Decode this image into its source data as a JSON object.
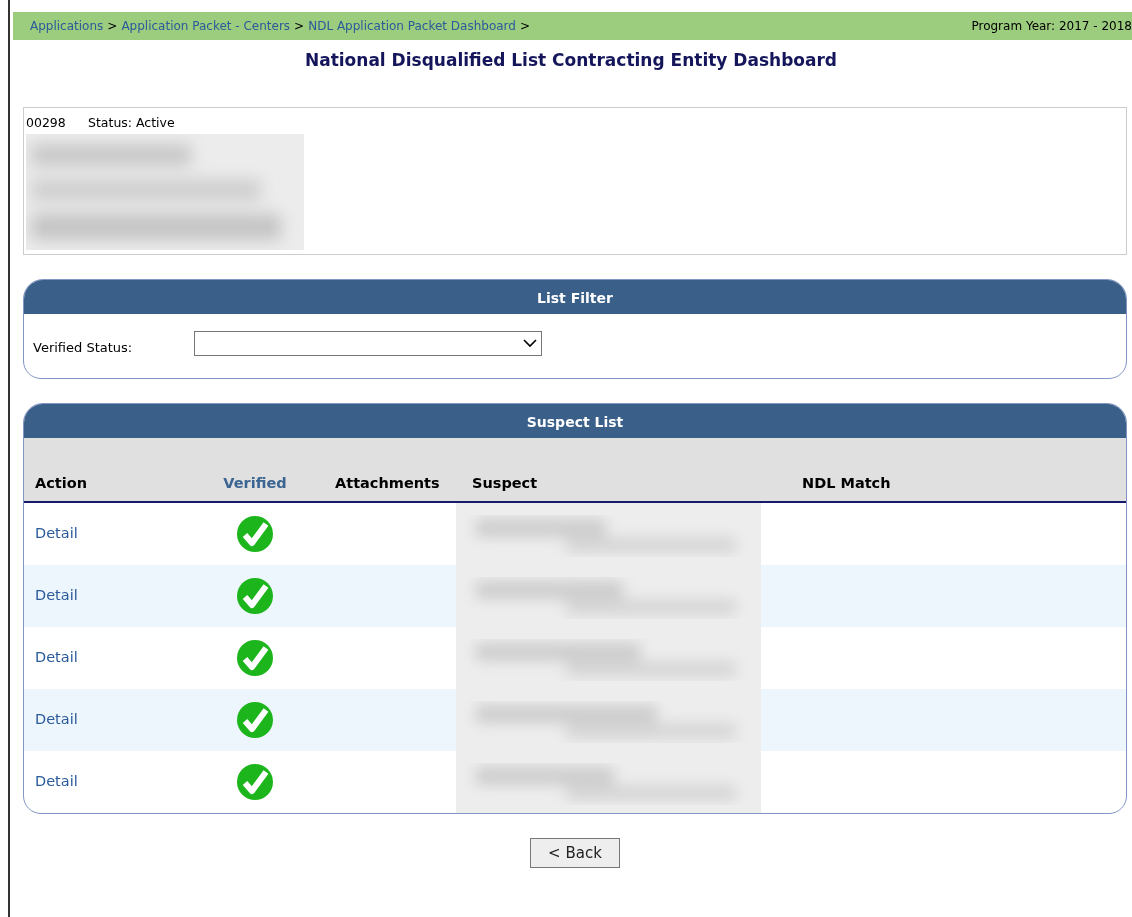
{
  "breadcrumb": {
    "items": [
      {
        "label": "Applications",
        "separator": ">"
      },
      {
        "label": "Application Packet - Centers",
        "separator": ">"
      },
      {
        "label": "NDL Application Packet Dashboard",
        "separator": ">"
      }
    ],
    "program_year": "Program Year: 2017 - 2018"
  },
  "title": "National Disqualified List Contracting Entity Dashboard",
  "entity": {
    "id": "00298",
    "status": "Status: Active"
  },
  "filter": {
    "title": "List Filter",
    "label": "Verified Status:"
  },
  "suspect_list": {
    "title": "Suspect List",
    "columns": [
      {
        "label": "Action",
        "sortable": false
      },
      {
        "label": "Verified",
        "sortable": true
      },
      {
        "label": "Attachments",
        "sortable": false
      },
      {
        "label": "Suspect",
        "sortable": false
      },
      {
        "label": "NDL Match",
        "sortable": false
      }
    ],
    "rows": [
      {
        "action": "Detail",
        "verified": true
      },
      {
        "action": "Detail",
        "verified": true
      },
      {
        "action": "Detail",
        "verified": true
      },
      {
        "action": "Detail",
        "verified": true
      },
      {
        "action": "Detail",
        "verified": true
      }
    ]
  },
  "back_button": "< Back"
}
